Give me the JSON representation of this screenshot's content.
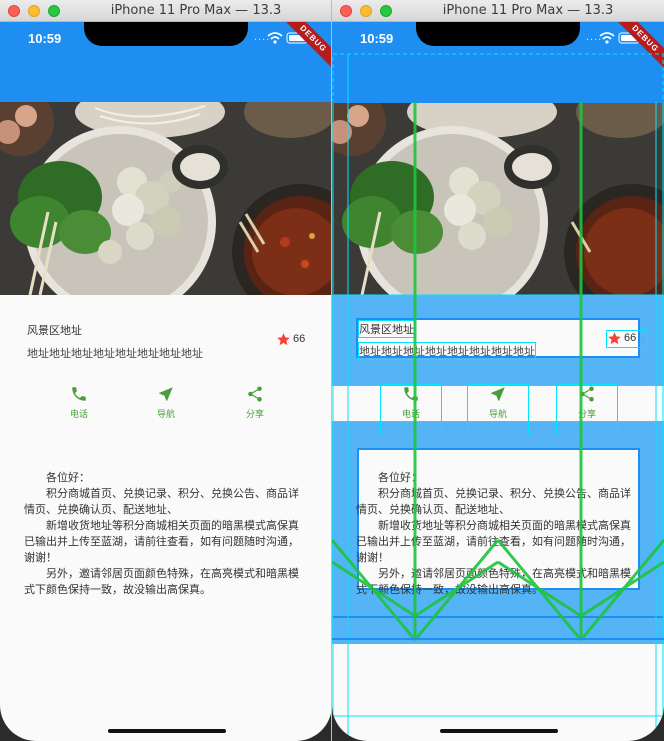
{
  "simulators": [
    {
      "window_title": "iPhone 11 Pro Max — 13.3"
    },
    {
      "window_title": "iPhone 11 Pro Max — 13.3"
    }
  ],
  "status_bar": {
    "time": "10:59",
    "signal_dots": "....",
    "debug_banner": "DEBUG"
  },
  "hero_image": {
    "icon": "food-photo-image"
  },
  "title_section": {
    "name": "风景区地址",
    "address": "地址地址地址地址地址地址地址地址",
    "favorite_count": "66",
    "star_color": "#f44336"
  },
  "buttons": [
    {
      "icon": "phone-icon",
      "label": "电话"
    },
    {
      "icon": "navigation-icon",
      "label": "导航"
    },
    {
      "icon": "share-icon",
      "label": "分享"
    }
  ],
  "text_section": {
    "greeting": "各位好：",
    "paragraphs": [
      "积分商城首页、兑换记录、积分、兑换公告、商品详情页、兑换确认页、配送地址、",
      "新增收货地址等积分商城相关页面的暗黑模式高保真已输出并上传至蓝湖，请前往查看，如有问题随时沟通，谢谢！",
      "另外，邀请邻居页面颜色特殊，在高亮模式和暗黑模式下颜色保持一致，故没输出高保真。"
    ]
  },
  "colors": {
    "app_bar": "#1e8ef2",
    "button_accent": "#4a9d3a",
    "debug_paint_fill": "#54b4f6",
    "debug_paint_outline": "#00e5ff",
    "debug_baseline": "#1ec43c"
  }
}
